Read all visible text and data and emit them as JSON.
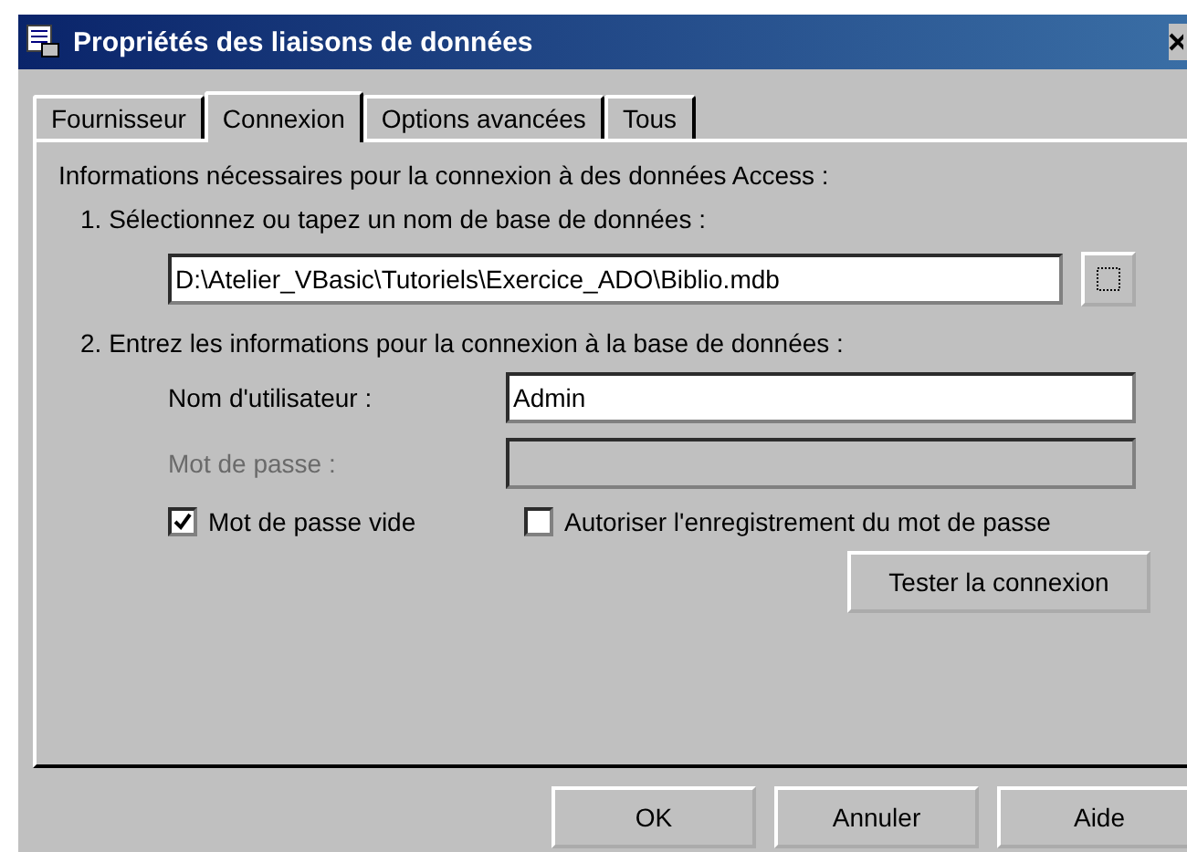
{
  "window": {
    "title": "Propriétés des liaisons de données"
  },
  "tabs": [
    {
      "label": "Fournisseur",
      "selected": false
    },
    {
      "label": "Connexion",
      "selected": true
    },
    {
      "label": "Options avancées",
      "selected": false
    },
    {
      "label": "Tous",
      "selected": false
    }
  ],
  "intro": "Informations nécessaires pour la connexion à des données Access :",
  "step1": {
    "label": "1. Sélectionnez ou tapez un nom de base de données :",
    "value": "D:\\Atelier_VBasic\\Tutoriels\\Exercice_ADO\\Biblio.mdb"
  },
  "step2": {
    "label": "2. Entrez les informations pour la connexion à la base de données :"
  },
  "fields": [
    {
      "label": "Nom d'utilisateur :",
      "value": "Admin",
      "disabled": false
    },
    {
      "label": "Mot de passe :",
      "disabled": true
    }
  ],
  "checkboxes": [
    {
      "label": "Mot de passe vide",
      "checked": true
    },
    {
      "label": "Autoriser l'enregistrement du mot de passe",
      "checked": false
    }
  ],
  "test_button": "Tester la connexion",
  "buttons": [
    "OK",
    "Annuler",
    "Aide"
  ]
}
